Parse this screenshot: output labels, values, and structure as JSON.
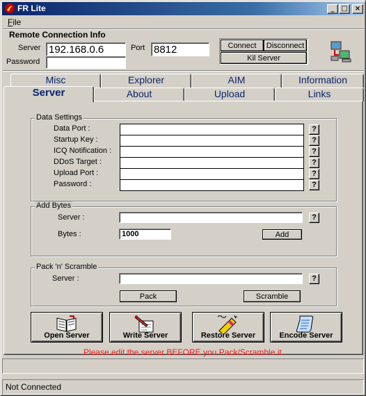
{
  "window": {
    "title": "FR Lite",
    "controls": {
      "minimize": "_",
      "maximize": "□",
      "close": "×"
    }
  },
  "menu": {
    "file_u": "F",
    "file_rest": "ile"
  },
  "connection": {
    "group_title": "Remote Connection Info",
    "server_label": "Server",
    "server_value": "192.168.0.6",
    "port_label": "Port",
    "port_value": "8812",
    "password_label": "Password",
    "password_value": "",
    "connect_label": "Connect",
    "disconnect_label": "Disconnect",
    "kill_label": "Kil Server"
  },
  "tabs": {
    "row_back": [
      "Misc",
      "Explorer",
      "AIM",
      "Information"
    ],
    "row_front": [
      "Server",
      "About",
      "Upload",
      "Links"
    ],
    "active": "Server"
  },
  "data_settings": {
    "title": "Data Settings",
    "fields": [
      {
        "label": "Data Port :",
        "value": ""
      },
      {
        "label": "Startup Key :",
        "value": ""
      },
      {
        "label": "ICQ Notification :",
        "value": ""
      },
      {
        "label": "DDoS Target :",
        "value": ""
      },
      {
        "label": "Upload Port :",
        "value": ""
      },
      {
        "label": "Password :",
        "value": ""
      }
    ],
    "help": "?"
  },
  "add_bytes": {
    "title": "Add Bytes",
    "server_label": "Server :",
    "server_value": "",
    "bytes_label": "Bytes :",
    "bytes_value": "1000",
    "add_label": "Add",
    "help": "?"
  },
  "pack": {
    "title": "Pack 'n' Scramble",
    "server_label": "Server :",
    "server_value": "",
    "pack_label": "Pack",
    "scramble_label": "Scramble",
    "help": "?"
  },
  "actions": {
    "open_label": "Open Server",
    "write_label": "Write Server",
    "restore_label": "Restore Server",
    "encode_label": "Encode Server"
  },
  "warning": "Please edit the server BEFORE you Pack/Scramble it.",
  "status": {
    "lower": "Not Connected"
  },
  "colors": {
    "title_start": "#0a246a",
    "title_end": "#a6caf0",
    "tab_text": "#0a246a",
    "warning": "#e8201c"
  }
}
